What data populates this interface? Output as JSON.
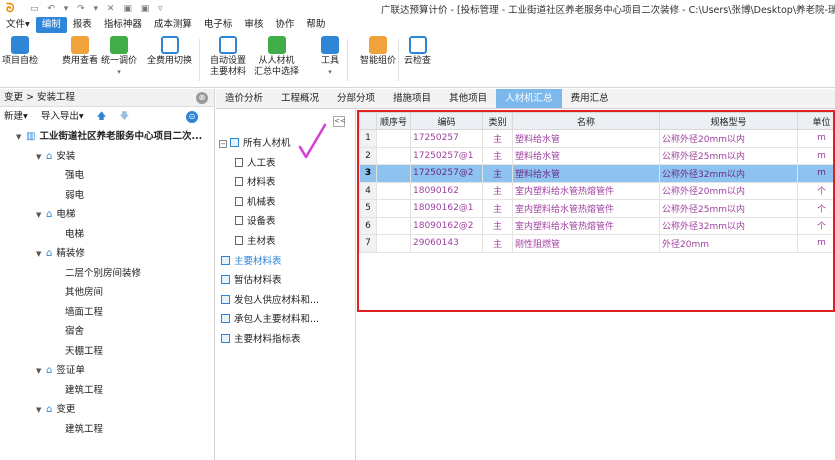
{
  "window": {
    "title": "广联达预算计价 - [投标管理 - 工业街道社区养老服务中心项目二次装修 - C:\\Users\\张博\\Desktop\\养老院-瑞",
    "quick_access": "▭ ↶ ▾ ↷ ▾ ✕ ▣ ▣ ▿"
  },
  "menu": [
    "文件▾",
    "编制",
    "报表",
    "指标神器",
    "成本测算",
    "电子标",
    "审核",
    "协作",
    "帮助"
  ],
  "menu_active_index": 1,
  "ribbon": [
    {
      "label": "项目自检",
      "label2": "",
      "caret": false
    },
    {
      "label": "费用查看",
      "label2": "",
      "caret": false
    },
    {
      "label": "统一调价",
      "label2": "",
      "caret": true
    },
    {
      "label": "全费用切换",
      "label2": "",
      "caret": false
    },
    {
      "label": "自动设置",
      "label2": "主要材料",
      "caret": false
    },
    {
      "label": "从人材机",
      "label2": "汇总中选择",
      "caret": false
    },
    {
      "label": "工具",
      "label2": "",
      "caret": true
    },
    {
      "label": "智能组价",
      "label2": "",
      "caret": false
    },
    {
      "label": "云检查",
      "label2": "",
      "caret": false
    }
  ],
  "left_panel": {
    "breadcrumb": "变更 > 安装工程",
    "new_label": "新建▾",
    "import_export_label": "导入导出▾",
    "up_arrow": "🡅",
    "down_arrow": "🡇",
    "settings_glyph": "⊗",
    "gear_glyph": "⊙",
    "tree": [
      {
        "label": "工业街道社区养老服务中心项目二次...",
        "level": 0,
        "icon": "building",
        "expanded": true
      },
      {
        "label": "安装",
        "level": 1,
        "icon": "house",
        "expanded": true
      },
      {
        "label": "强电",
        "level": 2
      },
      {
        "label": "弱电",
        "level": 2
      },
      {
        "label": "电梯",
        "level": 1,
        "icon": "house",
        "expanded": true
      },
      {
        "label": "电梯",
        "level": 2
      },
      {
        "label": "精装修",
        "level": 1,
        "icon": "house",
        "expanded": true
      },
      {
        "label": "二层个别房间装修",
        "level": 2
      },
      {
        "label": "其他房间",
        "level": 2
      },
      {
        "label": "墙面工程",
        "level": 2
      },
      {
        "label": "宿舍",
        "level": 2
      },
      {
        "label": "天棚工程",
        "level": 2
      },
      {
        "label": "签证单",
        "level": 1,
        "icon": "house",
        "expanded": true
      },
      {
        "label": "建筑工程",
        "level": 2
      },
      {
        "label": "变更",
        "level": 1,
        "icon": "house",
        "expanded": true
      },
      {
        "label": "建筑工程",
        "level": 2
      }
    ]
  },
  "tabs": [
    "造价分析",
    "工程概况",
    "分部分项",
    "措施项目",
    "其他项目",
    "人材机汇总",
    "费用汇总"
  ],
  "active_tab_index": 5,
  "collapse_glyph": "<<",
  "material_tree": [
    {
      "label": "所有人材机",
      "type": "root"
    },
    {
      "label": "人工表",
      "type": "doc"
    },
    {
      "label": "材料表",
      "type": "doc"
    },
    {
      "label": "机械表",
      "type": "doc"
    },
    {
      "label": "设备表",
      "type": "doc"
    },
    {
      "label": "主材表",
      "type": "doc"
    },
    {
      "label": "主要材料表",
      "type": "book",
      "selected": true
    },
    {
      "label": "暂估材料表",
      "type": "book"
    },
    {
      "label": "发包人供应材料和...",
      "type": "book"
    },
    {
      "label": "承包人主要材料和...",
      "type": "book"
    },
    {
      "label": "主要材料指标表",
      "type": "book"
    }
  ],
  "grid": {
    "headers": [
      "",
      "顺序号",
      "编码",
      "类别",
      "名称",
      "规格型号",
      "单位"
    ],
    "rows": [
      {
        "rn": "1",
        "seq": "",
        "code": "17250257",
        "cat": "主",
        "name": "塑料给水管",
        "spec": "公称外径20mm以内",
        "unit": "m"
      },
      {
        "rn": "2",
        "seq": "",
        "code": "17250257@1",
        "cat": "主",
        "name": "塑料给水管",
        "spec": "公称外径25mm以内",
        "unit": "m"
      },
      {
        "rn": "3",
        "seq": "",
        "code": "17250257@2",
        "cat": "主",
        "name": "塑料给水管",
        "spec": "公称外径32mm以内",
        "unit": "m",
        "selected": true
      },
      {
        "rn": "4",
        "seq": "",
        "code": "18090162",
        "cat": "主",
        "name": "室内塑料给水管热熔管件",
        "spec": "公称外径20mm以内",
        "unit": "个"
      },
      {
        "rn": "5",
        "seq": "",
        "code": "18090162@1",
        "cat": "主",
        "name": "室内塑料给水管热熔管件",
        "spec": "公称外径25mm以内",
        "unit": "个"
      },
      {
        "rn": "6",
        "seq": "",
        "code": "18090162@2",
        "cat": "主",
        "name": "室内塑料给水管热熔管件",
        "spec": "公称外径32mm以内",
        "unit": "个"
      },
      {
        "rn": "7",
        "seq": "",
        "code": "29060143",
        "cat": "主",
        "name": "刚性阻燃管",
        "spec": "外径20mm",
        "unit": "m"
      }
    ]
  },
  "colors": {
    "accent": "#2d86d9",
    "selected_row": "#8fc3ef",
    "highlight_box": "#e02020",
    "material_text": "#a040a0",
    "checkmark": "#d63fd6"
  }
}
